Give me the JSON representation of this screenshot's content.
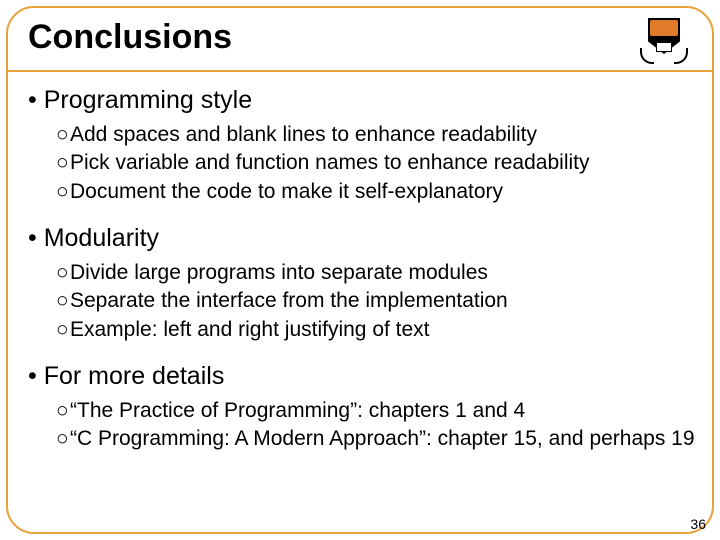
{
  "title": "Conclusions",
  "page_number": "36",
  "sections": [
    {
      "heading": "Programming style",
      "items": [
        "Add spaces and blank lines to enhance readability",
        "Pick variable and function names to enhance readability",
        "Document the code to make it self-explanatory"
      ]
    },
    {
      "heading": "Modularity",
      "items": [
        "Divide large programs into separate modules",
        "Separate the interface from the implementation",
        "Example: left and right justifying of text"
      ]
    },
    {
      "heading": "For more details",
      "items": [
        "“The Practice of Programming”: chapters 1 and 4",
        "“C Programming: A Modern Approach”: chapter 15, and perhaps 19"
      ]
    }
  ]
}
